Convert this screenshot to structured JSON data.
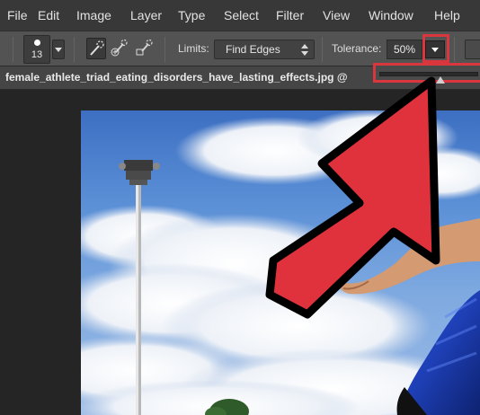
{
  "menu": {
    "items": [
      "File",
      "Edit",
      "Image",
      "Layer",
      "Type",
      "Select",
      "Filter",
      "View",
      "Window",
      "Help"
    ]
  },
  "options": {
    "brush_size": "13",
    "limits_label": "Limits:",
    "limits_value": "Find Edges",
    "tolerance_label": "Tolerance:",
    "tolerance_value": "50%",
    "tolerance_slider_fraction": 0.62
  },
  "document": {
    "title": "female_athlete_triad_eating_disorders_have_lasting_effects.jpg @"
  },
  "colors": {
    "highlight": "#d9363e",
    "arrow_fill": "#e0323c",
    "arrow_outline": "#000000"
  },
  "icons": [
    "brush-preset-icon",
    "quick-selection-icon",
    "add-to-selection-icon",
    "subtract-from-selection-icon",
    "dropdown-arrow-icon",
    "pointer-arrow-icon"
  ]
}
